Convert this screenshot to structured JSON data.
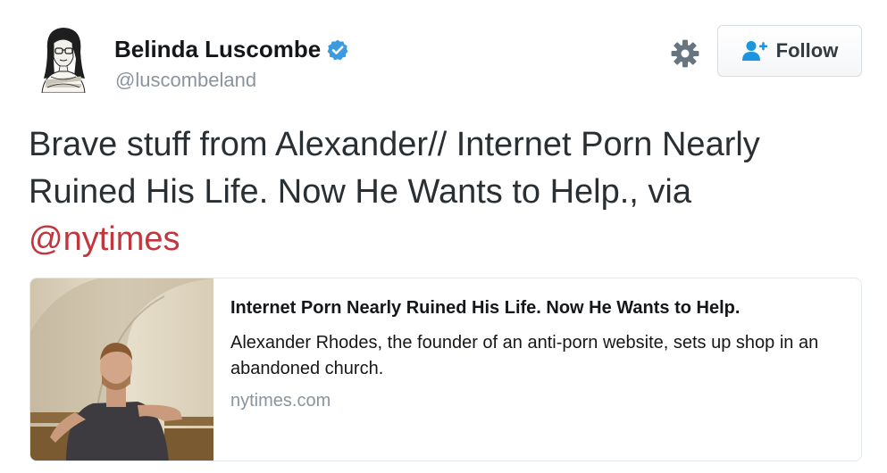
{
  "author": {
    "display_name": "Belinda Luscombe",
    "handle": "@luscombeland",
    "verified": true
  },
  "actions": {
    "follow_label": "Follow"
  },
  "tweet": {
    "text": "Brave stuff from Alexander// Internet Porn Nearly Ruined His Life. Now He Wants to Help., via ",
    "mention": "@nytimes"
  },
  "card": {
    "title": "Internet Porn Nearly Ruined His Life. Now He Wants to Help.",
    "description": "Alexander Rhodes, the founder of an anti-porn website, sets up shop in an abandoned church.",
    "domain": "nytimes.com"
  },
  "colors": {
    "verified_badge": "#3a9be0",
    "mention": "#c2363d",
    "follow_icon": "#1b95e0"
  }
}
